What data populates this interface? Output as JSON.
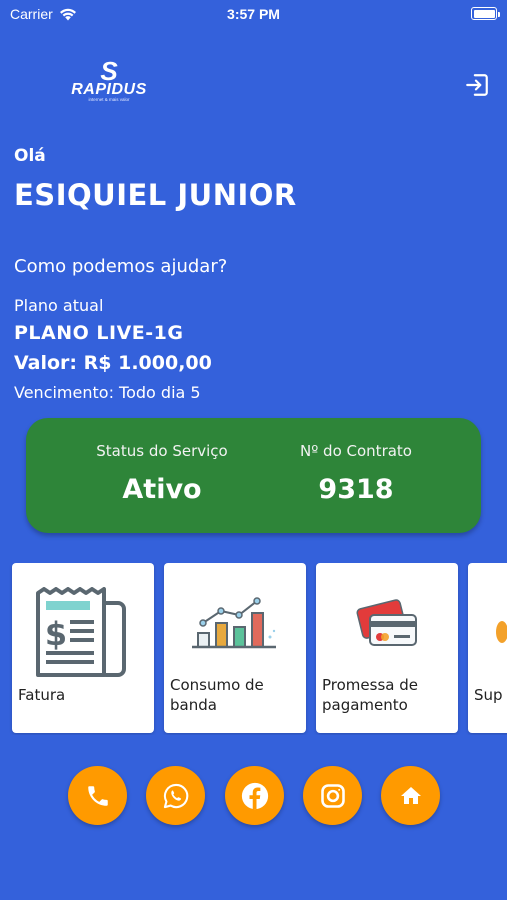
{
  "status_bar": {
    "carrier": "Carrier",
    "time": "3:57 PM"
  },
  "header": {
    "logo_text": "RAPIDUS",
    "logo_letter": "S",
    "logo_tagline": "internet & mais valor"
  },
  "greeting": {
    "hello": "Olá",
    "name": "ESIQUIEL JUNIOR",
    "help": "Como podemos ajudar?"
  },
  "plan": {
    "label": "Plano atual",
    "name": "PLANO LIVE-1G",
    "value": "Valor: R$ 1.000,00",
    "due": "Vencimento: Todo dia 5"
  },
  "service_card": {
    "status_label": "Status do Serviço",
    "status_value": "Ativo",
    "contract_label": "Nº do Contrato",
    "contract_value": "9318"
  },
  "actions": [
    {
      "label": "Fatura",
      "icon": "invoice-icon"
    },
    {
      "label": "Consumo de banda",
      "icon": "bar-chart-icon"
    },
    {
      "label": "Promessa de pagamento",
      "icon": "credit-card-icon"
    },
    {
      "label": "Sup",
      "icon": "support-icon"
    }
  ],
  "contact_buttons": [
    {
      "icon": "phone-icon"
    },
    {
      "icon": "whatsapp-icon"
    },
    {
      "icon": "facebook-icon"
    },
    {
      "icon": "instagram-icon"
    },
    {
      "icon": "home-icon"
    }
  ],
  "colors": {
    "background": "#3461DB",
    "status_card": "#2E8539",
    "accent_button": "#FF9A00"
  }
}
